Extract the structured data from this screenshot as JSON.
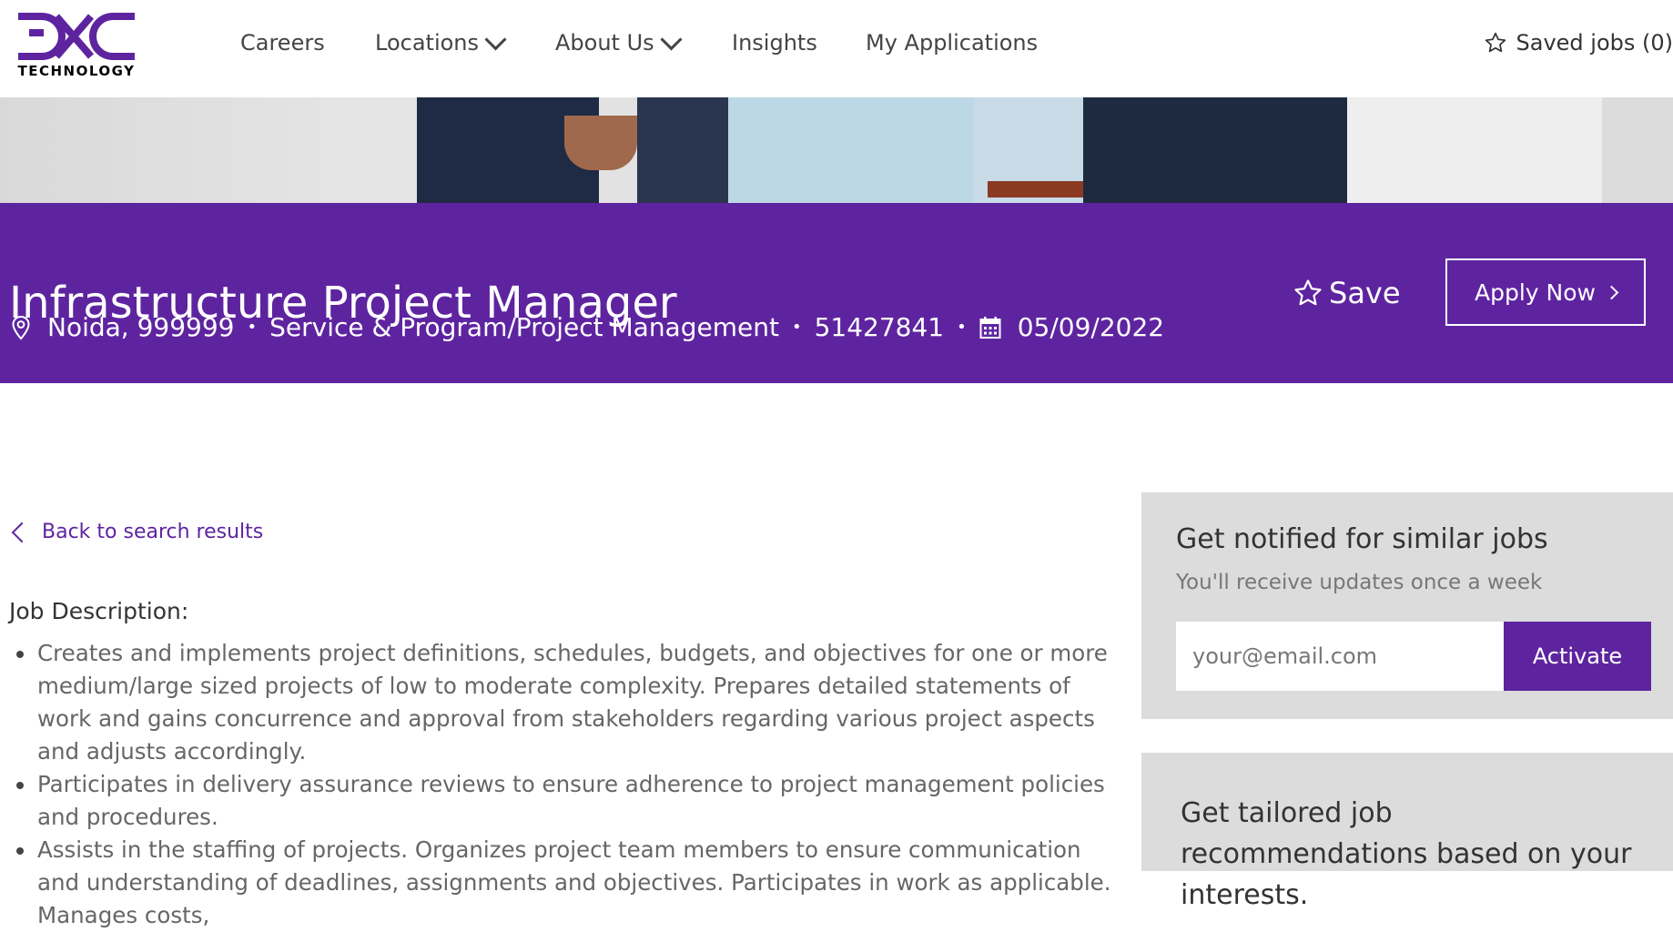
{
  "brand": {
    "logo_sub": "TECHNOLOGY",
    "accent": "#5e24a0"
  },
  "nav": {
    "careers": "Careers",
    "locations": "Locations",
    "about": "About Us",
    "insights": "Insights",
    "applications": "My Applications",
    "saved_jobs": "Saved jobs (0)"
  },
  "job": {
    "title": "Infrastructure Project Manager",
    "location": "Noida, 999999",
    "category": "Service & Program/Project Management",
    "id": "51427841",
    "date": "05/09/2022",
    "save_label": "Save",
    "apply_label": "Apply Now"
  },
  "main": {
    "back_label": "Back to search results",
    "description_heading": "Job Description:",
    "bullets": [
      "Creates and implements project definitions, schedules, budgets, and objectives for one or more medium/large sized projects of low to moderate complexity. Prepares detailed statements of work and gains concurrence and approval from stakeholders regarding various project aspects and adjusts accordingly.",
      "Participates in delivery assurance reviews to ensure adherence to project management policies and procedures.",
      "Assists in the staffing of projects. Organizes project team members to ensure communication and understanding of deadlines, assignments and objectives. Participates in work as applicable. Manages costs,"
    ]
  },
  "notify": {
    "heading": "Get notified for similar jobs",
    "subheading": "You'll receive updates once a week",
    "email_placeholder": "your@email.com",
    "activate_label": "Activate"
  },
  "recommend": {
    "heading": "Get tailored job recommendations based on your interests."
  }
}
